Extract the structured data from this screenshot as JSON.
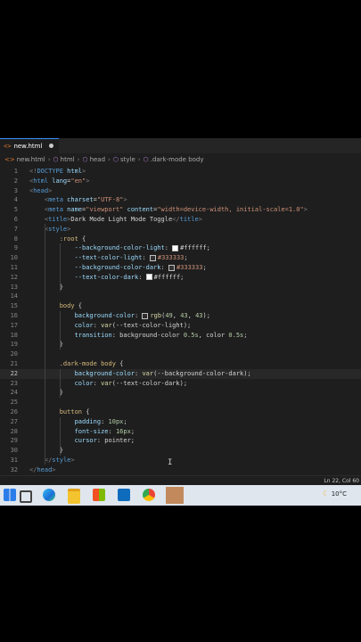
{
  "tab": {
    "icon": "html-file-icon",
    "label": "new.html"
  },
  "breadcrumb": {
    "file": "new.html",
    "items": [
      "html",
      "head",
      "style",
      ".dark-mode body"
    ]
  },
  "lines": [
    {
      "n": "1",
      "tokens": [
        [
          "t-punc",
          "<!"
        ],
        [
          "t-tag",
          "DOCTYPE"
        ],
        [
          "t-attr",
          " html"
        ],
        [
          "t-punc",
          ">"
        ]
      ]
    },
    {
      "n": "2",
      "tokens": [
        [
          "t-punc",
          "<"
        ],
        [
          "t-tag",
          "html"
        ],
        [
          "t-attr",
          " lang"
        ],
        [
          "t-txt",
          "="
        ],
        [
          "t-str",
          "\"en\""
        ],
        [
          "t-punc",
          ">"
        ]
      ]
    },
    {
      "n": "3",
      "tokens": [
        [
          "t-punc",
          "<"
        ],
        [
          "t-tag",
          "head"
        ],
        [
          "t-punc",
          ">"
        ]
      ]
    },
    {
      "n": "4",
      "tokens": [
        [
          "t-txt",
          "    "
        ],
        [
          "t-punc",
          "<"
        ],
        [
          "t-tag",
          "meta"
        ],
        [
          "t-attr",
          " charset"
        ],
        [
          "t-txt",
          "="
        ],
        [
          "t-str",
          "\"UTF-8\""
        ],
        [
          "t-punc",
          ">"
        ]
      ]
    },
    {
      "n": "5",
      "tokens": [
        [
          "t-txt",
          "    "
        ],
        [
          "t-punc",
          "<"
        ],
        [
          "t-tag",
          "meta"
        ],
        [
          "t-attr",
          " name"
        ],
        [
          "t-txt",
          "="
        ],
        [
          "t-str",
          "\"viewport\""
        ],
        [
          "t-attr",
          " content"
        ],
        [
          "t-txt",
          "="
        ],
        [
          "t-str",
          "\"width=device-width, initial-scale=1.0\""
        ],
        [
          "t-punc",
          ">"
        ]
      ]
    },
    {
      "n": "6",
      "tokens": [
        [
          "t-txt",
          "    "
        ],
        [
          "t-punc",
          "<"
        ],
        [
          "t-tag",
          "title"
        ],
        [
          "t-punc",
          ">"
        ],
        [
          "t-txt",
          "Dark Mode Light Mode Toggle"
        ],
        [
          "t-punc",
          "</"
        ],
        [
          "t-tag",
          "title"
        ],
        [
          "t-punc",
          ">"
        ]
      ]
    },
    {
      "n": "7",
      "tokens": [
        [
          "t-txt",
          "    "
        ],
        [
          "t-punc",
          "<"
        ],
        [
          "t-tag",
          "style"
        ],
        [
          "t-punc",
          ">"
        ]
      ]
    },
    {
      "n": "8",
      "tokens": [
        [
          "t-txt",
          "        "
        ],
        [
          "t-sel",
          ":root"
        ],
        [
          "t-txt",
          " {"
        ]
      ]
    },
    {
      "n": "9",
      "tokens": [
        [
          "t-txt",
          "            "
        ],
        [
          "t-prop",
          "--background-color-light"
        ],
        [
          "t-txt",
          ": "
        ],
        [
          "swatch",
          "#ffffff"
        ],
        [
          "t-txt",
          "#ffffff;"
        ]
      ]
    },
    {
      "n": "10",
      "tokens": [
        [
          "t-txt",
          "            "
        ],
        [
          "t-prop",
          "--text-color-light"
        ],
        [
          "t-txt",
          ": "
        ],
        [
          "swatch",
          "#333333"
        ],
        [
          "t-kw",
          "#333333"
        ],
        [
          "t-txt",
          ";"
        ]
      ]
    },
    {
      "n": "11",
      "tokens": [
        [
          "t-txt",
          "            "
        ],
        [
          "t-prop",
          "--background-color-dark"
        ],
        [
          "t-txt",
          ": "
        ],
        [
          "swatch",
          "#333333"
        ],
        [
          "t-kw",
          "#333333"
        ],
        [
          "t-txt",
          ";"
        ]
      ]
    },
    {
      "n": "12",
      "tokens": [
        [
          "t-txt",
          "            "
        ],
        [
          "t-prop",
          "--text-color-dark"
        ],
        [
          "t-txt",
          ": "
        ],
        [
          "swatch",
          "#ffffff"
        ],
        [
          "t-txt",
          "#ffffff;"
        ]
      ]
    },
    {
      "n": "13",
      "tokens": [
        [
          "t-txt",
          "        }"
        ]
      ]
    },
    {
      "n": "14",
      "tokens": []
    },
    {
      "n": "15",
      "tokens": [
        [
          "t-txt",
          "        "
        ],
        [
          "t-sel",
          "body"
        ],
        [
          "t-txt",
          " {"
        ]
      ]
    },
    {
      "n": "16",
      "tokens": [
        [
          "t-txt",
          "            "
        ],
        [
          "t-prop",
          "background-color"
        ],
        [
          "t-txt",
          ": "
        ],
        [
          "swatch",
          "#312b2b"
        ],
        [
          "t-fn",
          "rgb"
        ],
        [
          "t-txt",
          "("
        ],
        [
          "t-num",
          "49"
        ],
        [
          "t-txt",
          ", "
        ],
        [
          "t-num",
          "43"
        ],
        [
          "t-txt",
          ", "
        ],
        [
          "t-num",
          "43"
        ],
        [
          "t-txt",
          ");"
        ]
      ]
    },
    {
      "n": "17",
      "tokens": [
        [
          "t-txt",
          "            "
        ],
        [
          "t-prop",
          "color"
        ],
        [
          "t-txt",
          ": "
        ],
        [
          "t-fn",
          "var"
        ],
        [
          "t-txt",
          "(--text-color-light);"
        ]
      ]
    },
    {
      "n": "18",
      "tokens": [
        [
          "t-txt",
          "            "
        ],
        [
          "t-prop",
          "transition"
        ],
        [
          "t-txt",
          ": background-color "
        ],
        [
          "t-num",
          "0.5s"
        ],
        [
          "t-txt",
          ", color "
        ],
        [
          "t-num",
          "0.5s"
        ],
        [
          "t-txt",
          ";"
        ]
      ]
    },
    {
      "n": "19",
      "tokens": [
        [
          "t-txt",
          "        }"
        ]
      ]
    },
    {
      "n": "20",
      "tokens": []
    },
    {
      "n": "21",
      "tokens": [
        [
          "t-txt",
          "        "
        ],
        [
          "t-sel",
          ".dark-mode body"
        ],
        [
          "t-txt",
          " {"
        ]
      ]
    },
    {
      "n": "22",
      "tokens": [
        [
          "t-txt",
          "            "
        ],
        [
          "t-prop",
          "background-color"
        ],
        [
          "t-txt",
          ": "
        ],
        [
          "t-fn",
          "var"
        ],
        [
          "t-txt",
          "(--background-color-dark);"
        ]
      ]
    },
    {
      "n": "23",
      "tokens": [
        [
          "t-txt",
          "            "
        ],
        [
          "t-prop",
          "color"
        ],
        [
          "t-txt",
          ": "
        ],
        [
          "t-fn",
          "var"
        ],
        [
          "t-txt",
          "(--text-color-dark);"
        ]
      ]
    },
    {
      "n": "24",
      "tokens": [
        [
          "t-txt",
          "        }"
        ]
      ]
    },
    {
      "n": "25",
      "tokens": []
    },
    {
      "n": "26",
      "tokens": [
        [
          "t-txt",
          "        "
        ],
        [
          "t-sel",
          "button"
        ],
        [
          "t-txt",
          " {"
        ]
      ]
    },
    {
      "n": "27",
      "tokens": [
        [
          "t-txt",
          "            "
        ],
        [
          "t-prop",
          "padding"
        ],
        [
          "t-txt",
          ": "
        ],
        [
          "t-num",
          "10px"
        ],
        [
          "t-txt",
          ";"
        ]
      ]
    },
    {
      "n": "28",
      "tokens": [
        [
          "t-txt",
          "            "
        ],
        [
          "t-prop",
          "font-size"
        ],
        [
          "t-txt",
          ": "
        ],
        [
          "t-num",
          "16px"
        ],
        [
          "t-txt",
          ";"
        ]
      ]
    },
    {
      "n": "29",
      "tokens": [
        [
          "t-txt",
          "            "
        ],
        [
          "t-prop",
          "cursor"
        ],
        [
          "t-txt",
          ": pointer;"
        ]
      ]
    },
    {
      "n": "30",
      "tokens": [
        [
          "t-txt",
          "        }"
        ]
      ]
    },
    {
      "n": "31",
      "tokens": [
        [
          "t-txt",
          "    "
        ],
        [
          "t-punc",
          "</"
        ],
        [
          "t-tag",
          "style"
        ],
        [
          "t-punc",
          ">"
        ]
      ]
    },
    {
      "n": "32",
      "tokens": [
        [
          "t-punc",
          "</"
        ],
        [
          "t-tag",
          "head"
        ],
        [
          "t-punc",
          ">"
        ]
      ]
    }
  ],
  "active_line": "22",
  "status": {
    "position": "Ln 22, Col 60"
  },
  "taskbar": {
    "apps": [
      "windows-start-icon",
      "task-view-icon",
      "edge-icon",
      "file-explorer-icon",
      "store-icon",
      "mail-icon",
      "chrome-icon",
      "vscode-icon"
    ],
    "weather": {
      "icon": "moon-icon",
      "temp": "10°C"
    }
  }
}
